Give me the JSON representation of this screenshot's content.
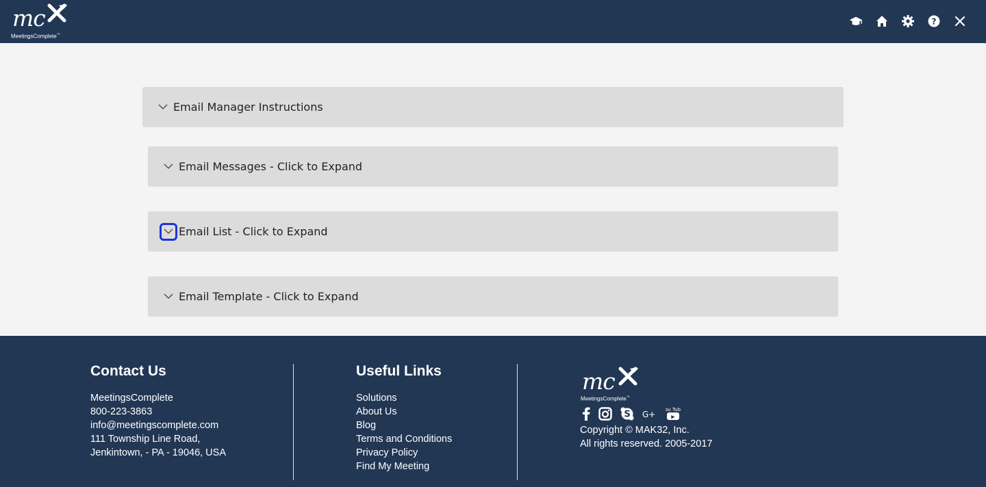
{
  "header": {
    "logo_text": "mc",
    "brand_name": "MeetingsComplete",
    "brand_tm": "™",
    "icons": [
      "graduation-cap-icon",
      "home-icon",
      "gear-icon",
      "help-icon",
      "close-icon"
    ]
  },
  "panels": [
    {
      "label": "Email Manager Instructions"
    },
    {
      "label": "Email Messages - Click to Expand"
    },
    {
      "label": "Email List - Click to Expand"
    },
    {
      "label": "Email Template - Click to Expand"
    }
  ],
  "footer": {
    "contact": {
      "title": "Contact Us",
      "lines": [
        "MeetingsComplete",
        "800-223-3863",
        "info@meetingscomplete.com",
        "111 Township Line Road,",
        "Jenkintown, - PA - 19046, USA"
      ]
    },
    "links": {
      "title": "Useful Links",
      "items": [
        "Solutions",
        "About Us",
        "Blog",
        "Terms and Conditions",
        "Privacy Policy",
        "Find My Meeting"
      ]
    },
    "brand": {
      "logo_text": "mc",
      "brand_name": "MeetingsComplete",
      "brand_tm": "™",
      "social_icons": [
        "facebook-icon",
        "instagram-icon",
        "skype-icon",
        "google-plus-icon",
        "youtube-icon"
      ],
      "social_text": {
        "google_plus": "G+",
        "youtube": "You Tube"
      },
      "copyright_line1": "Copyright © MAK32, Inc.",
      "copyright_line2": "All rights reserved. 2005-2017"
    }
  },
  "colors": {
    "header_bg": "#223754",
    "footer_bg": "#223754",
    "panel_bg": "#dcdcdc",
    "page_bg": "#f4f4f4",
    "focus_outline": "#1a35d8"
  }
}
